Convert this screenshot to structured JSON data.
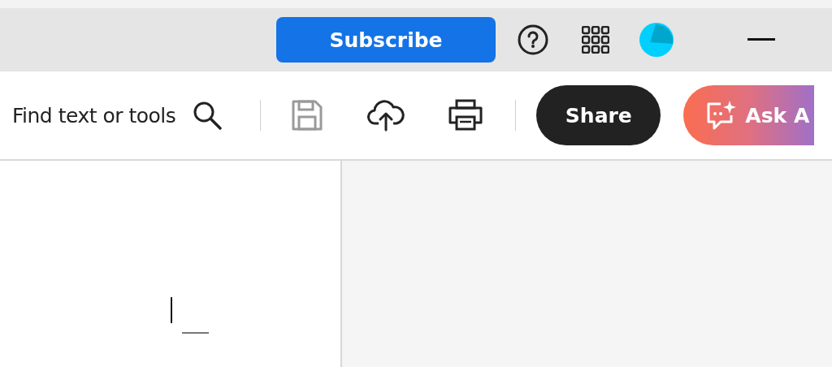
{
  "header": {
    "subscribe_button": "Subscribe"
  },
  "toolbar": {
    "search": {
      "label": "Find text or tools"
    },
    "save": {
      "disabled": true
    },
    "share_button": "Share",
    "ask_button": "Ask A"
  }
}
